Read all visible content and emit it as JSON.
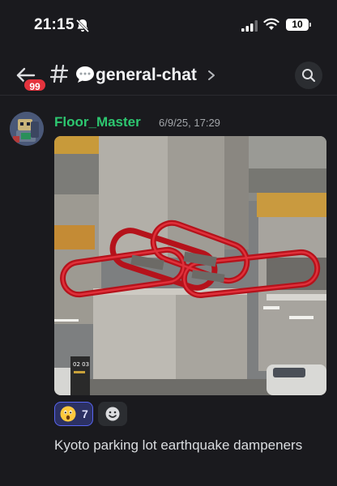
{
  "status_bar": {
    "time": "21:15",
    "battery_level": "10",
    "icons": [
      "bell-slash-icon",
      "signal-icon",
      "wifi-icon",
      "battery-icon"
    ]
  },
  "header": {
    "channel_name": "general-chat",
    "channel_emoji": "speech-bubble-icon",
    "unread_count": "99",
    "icons": [
      "back-arrow-icon",
      "hash-icon",
      "chevron-right-icon",
      "search-icon"
    ]
  },
  "message": {
    "author": "Floor_Master",
    "timestamp": "6/9/25, 17:29",
    "text": "Kyoto parking lot earthquake dampeners",
    "attachment": {
      "type": "photo",
      "sign_text": "02 03"
    },
    "reactions": [
      {
        "emoji": "astonished-face-icon",
        "count": "7",
        "reacted": true
      }
    ]
  },
  "colors": {
    "background": "#1a1a1e",
    "author": "#2dc770",
    "badge": "#e4333d",
    "reaction_active_bg": "#2c3163",
    "reaction_active_border": "#5865f2"
  }
}
